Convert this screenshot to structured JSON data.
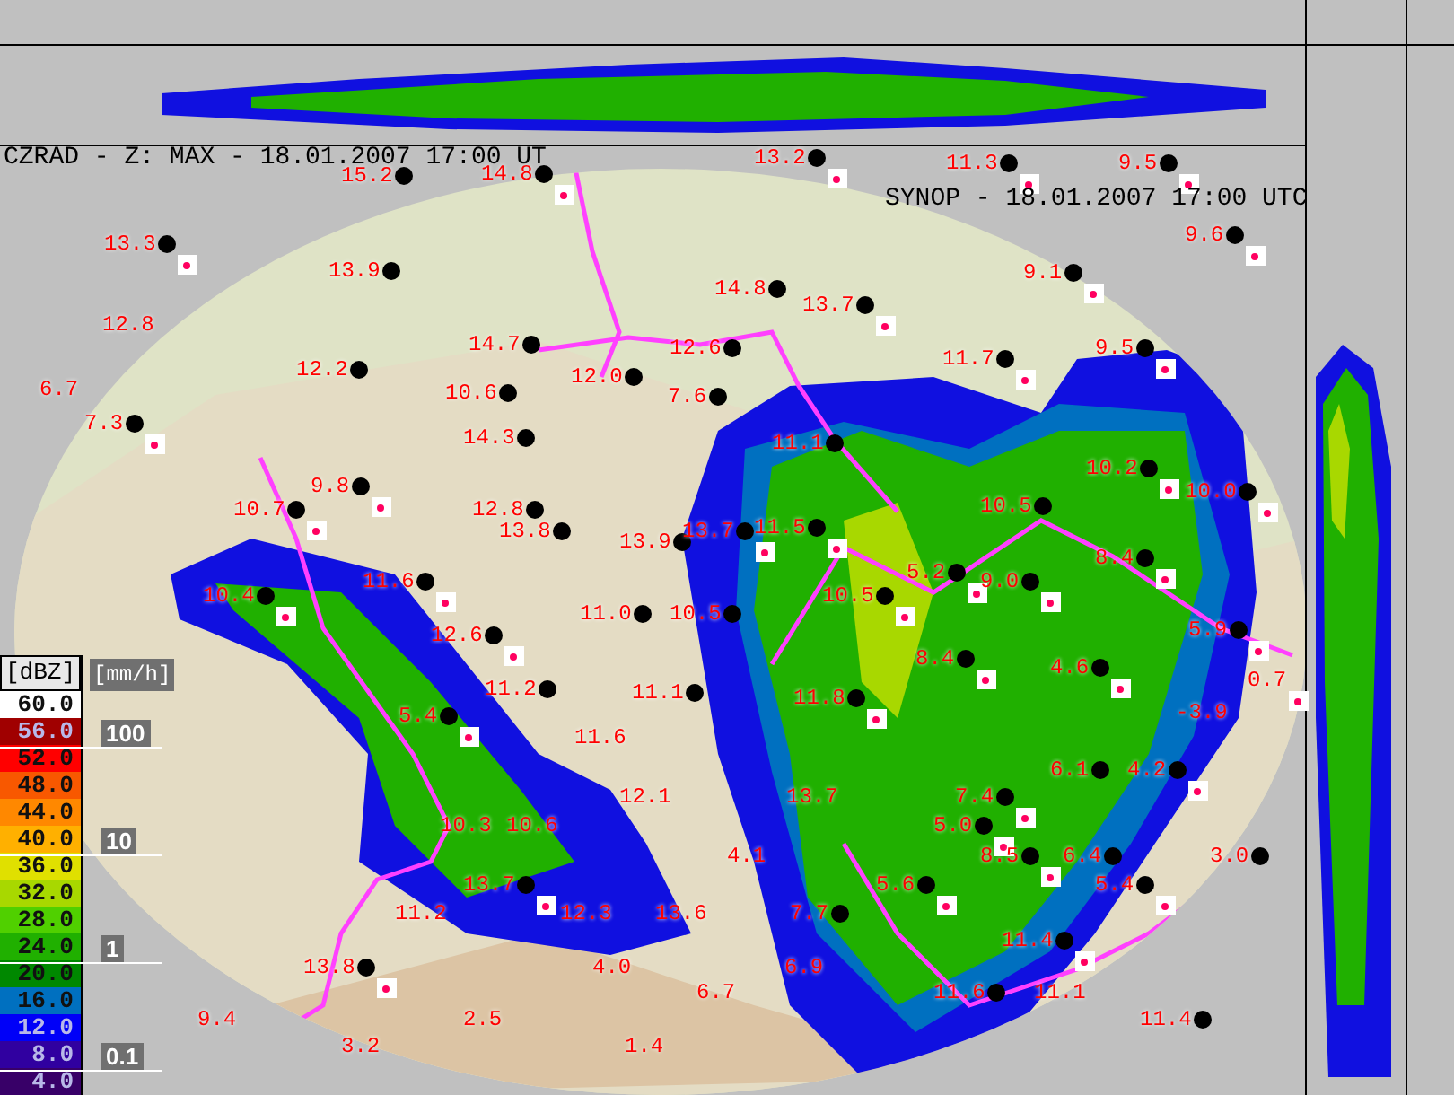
{
  "header": {
    "title": "CZRAD - Z: MAX - 18.01.2007 17:00 UT",
    "synop": "SYNOP - 18.01.2007 17:00 UTC"
  },
  "legend": {
    "unit": "[dBZ]",
    "rate_unit": "[mm/h]",
    "levels": [
      {
        "label": "60.0",
        "color": "#ffffff"
      },
      {
        "label": "56.0",
        "color": "#a00000"
      },
      {
        "label": "52.0",
        "color": "#ff0000"
      },
      {
        "label": "48.0",
        "color": "#f85800"
      },
      {
        "label": "44.0",
        "color": "#ff8800"
      },
      {
        "label": "40.0",
        "color": "#ffb000"
      },
      {
        "label": "36.0",
        "color": "#e0e000"
      },
      {
        "label": "32.0",
        "color": "#a8d800"
      },
      {
        "label": "28.0",
        "color": "#50d000"
      },
      {
        "label": "24.0",
        "color": "#20b000"
      },
      {
        "label": "20.0",
        "color": "#008800"
      },
      {
        "label": "16.0",
        "color": "#0070c0"
      },
      {
        "label": "12.0",
        "color": "#0000f8"
      },
      {
        "label": "8.0",
        "color": "#3000a0"
      },
      {
        "label": "4.0",
        "color": "#380068"
      }
    ],
    "rates": [
      "100",
      "10",
      "1",
      "0.1"
    ]
  },
  "stations": [
    {
      "value": "15.2",
      "rain": false,
      "dot": true
    },
    {
      "value": "14.8",
      "rain": true,
      "dot": true
    },
    {
      "value": "13.2",
      "rain": true,
      "dot": true
    },
    {
      "value": "11.3",
      "rain": true,
      "dot": true
    },
    {
      "value": "9.5",
      "rain": true,
      "dot": true
    },
    {
      "value": "13.3",
      "rain": true,
      "dot": true
    },
    {
      "value": "9.6",
      "rain": true,
      "dot": true
    },
    {
      "value": "13.9",
      "rain": false,
      "dot": true
    },
    {
      "value": "9.1",
      "rain": true,
      "dot": true
    },
    {
      "value": "14.8",
      "rain": false,
      "dot": true
    },
    {
      "value": "13.7",
      "rain": true,
      "dot": true
    },
    {
      "value": "12.8",
      "rain": false,
      "dot": false
    },
    {
      "value": "14.7",
      "rain": false,
      "dot": true
    },
    {
      "value": "12.6",
      "rain": false,
      "dot": true
    },
    {
      "value": "11.7",
      "rain": true,
      "dot": true
    },
    {
      "value": "9.5",
      "rain": true,
      "dot": true
    },
    {
      "value": "12.2",
      "rain": false,
      "dot": true
    },
    {
      "value": "12.0",
      "rain": false,
      "dot": true
    },
    {
      "value": "6.7",
      "rain": false,
      "dot": false
    },
    {
      "value": "10.6",
      "rain": false,
      "dot": true
    },
    {
      "value": "7.6",
      "rain": false,
      "dot": true
    },
    {
      "value": "7.3",
      "rain": true,
      "dot": true
    },
    {
      "value": "14.3",
      "rain": false,
      "dot": true
    },
    {
      "value": "11.1",
      "rain": false,
      "dot": true
    },
    {
      "value": "10.2",
      "rain": true,
      "dot": true
    },
    {
      "value": "9.8",
      "rain": true,
      "dot": true
    },
    {
      "value": "10.5",
      "rain": false,
      "dot": true
    },
    {
      "value": "10.0",
      "rain": true,
      "dot": true
    },
    {
      "value": "10.7",
      "rain": true,
      "dot": true
    },
    {
      "value": "12.8",
      "rain": false,
      "dot": true
    },
    {
      "value": "13.8",
      "rain": false,
      "dot": true
    },
    {
      "value": "11.5",
      "rain": true,
      "dot": true
    },
    {
      "value": "13.9",
      "rain": false,
      "dot": true
    },
    {
      "value": "13.7",
      "rain": true,
      "dot": true
    },
    {
      "value": "8.4",
      "rain": true,
      "dot": true
    },
    {
      "value": "5.2",
      "rain": true,
      "dot": true
    },
    {
      "value": "11.6",
      "rain": true,
      "dot": true
    },
    {
      "value": "9.0",
      "rain": true,
      "dot": true
    },
    {
      "value": "10.4",
      "rain": true,
      "dot": true
    },
    {
      "value": "10.5",
      "rain": true,
      "dot": true
    },
    {
      "value": "11.0",
      "rain": false,
      "dot": true
    },
    {
      "value": "10.5",
      "rain": false,
      "dot": true
    },
    {
      "value": "5.9",
      "rain": true,
      "dot": true
    },
    {
      "value": "12.6",
      "rain": true,
      "dot": true
    },
    {
      "value": "8.4",
      "rain": true,
      "dot": true
    },
    {
      "value": "4.6",
      "rain": true,
      "dot": true
    },
    {
      "value": "11.2",
      "rain": false,
      "dot": true
    },
    {
      "value": "11.1",
      "rain": false,
      "dot": true
    },
    {
      "value": "11.8",
      "rain": true,
      "dot": true
    },
    {
      "value": "0.7",
      "rain": true,
      "dot": false
    },
    {
      "value": "-3.9",
      "rain": false,
      "dot": false
    },
    {
      "value": "5.4",
      "rain": true,
      "dot": true
    },
    {
      "value": "11.6",
      "rain": false,
      "dot": false
    },
    {
      "value": "6.1",
      "rain": false,
      "dot": true
    },
    {
      "value": "4.2",
      "rain": true,
      "dot": true
    },
    {
      "value": "12.1",
      "rain": false,
      "dot": false
    },
    {
      "value": "13.7",
      "rain": false,
      "dot": false
    },
    {
      "value": "7.4",
      "rain": true,
      "dot": true
    },
    {
      "value": "10.3",
      "rain": false,
      "dot": false
    },
    {
      "value": "10.6",
      "rain": false,
      "dot": false
    },
    {
      "value": "5.0",
      "rain": true,
      "dot": true
    },
    {
      "value": "4.1",
      "rain": false,
      "dot": false
    },
    {
      "value": "8.5",
      "rain": true,
      "dot": true
    },
    {
      "value": "6.4",
      "rain": false,
      "dot": true
    },
    {
      "value": "3.0",
      "rain": false,
      "dot": true
    },
    {
      "value": "13.7",
      "rain": true,
      "dot": true
    },
    {
      "value": "5.6",
      "rain": true,
      "dot": true
    },
    {
      "value": "5.4",
      "rain": true,
      "dot": true
    },
    {
      "value": "11.2",
      "rain": false,
      "dot": false
    },
    {
      "value": "12.3",
      "rain": false,
      "dot": false
    },
    {
      "value": "13.6",
      "rain": false,
      "dot": false
    },
    {
      "value": "7.7",
      "rain": false,
      "dot": true
    },
    {
      "value": "11.4",
      "rain": true,
      "dot": true
    },
    {
      "value": "13.8",
      "rain": true,
      "dot": true
    },
    {
      "value": "4.0",
      "rain": false,
      "dot": false
    },
    {
      "value": "6.9",
      "rain": false,
      "dot": false
    },
    {
      "value": "6.7",
      "rain": false,
      "dot": false
    },
    {
      "value": "11.6",
      "rain": false,
      "dot": true
    },
    {
      "value": "11.1",
      "rain": false,
      "dot": false
    },
    {
      "value": "9.4",
      "rain": false,
      "dot": false
    },
    {
      "value": "2.5",
      "rain": false,
      "dot": false
    },
    {
      "value": "11.4",
      "rain": false,
      "dot": true
    },
    {
      "value": "3.2",
      "rain": false,
      "dot": false
    },
    {
      "value": "1.4",
      "rain": false,
      "dot": false
    }
  ]
}
